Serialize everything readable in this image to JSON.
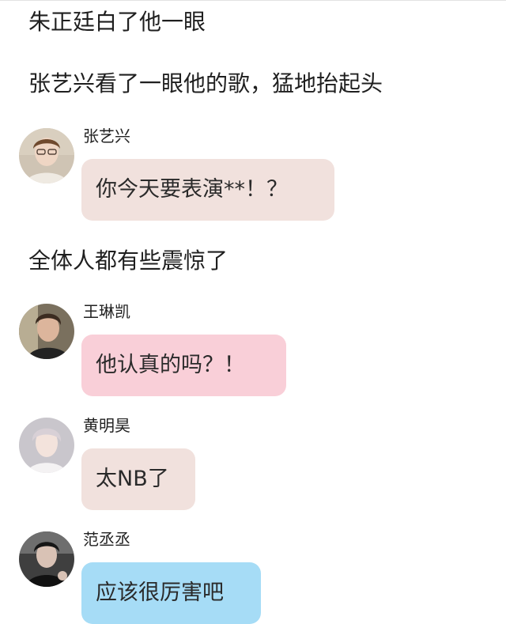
{
  "narration": [
    "朱正廷白了他一眼",
    "张艺兴看了一眼他的歌，猛地抬起头",
    "全体人都有些震惊了"
  ],
  "messages": [
    {
      "sender": "张艺兴",
      "text": "你今天要表演**！？",
      "bubble_color": "#f1e1dd",
      "avatar": "person-avatar"
    },
    {
      "sender": "王琳凯",
      "text": "他认真的吗？！",
      "bubble_color": "#f9cfd8",
      "avatar": "person-avatar"
    },
    {
      "sender": "黄明昊",
      "text": "太NB了",
      "bubble_color": "#f1e1dd",
      "avatar": "person-avatar"
    },
    {
      "sender": "范丞丞",
      "text": "应该很厉害吧",
      "bubble_color": "#a6dcf6",
      "avatar": "person-avatar"
    }
  ]
}
